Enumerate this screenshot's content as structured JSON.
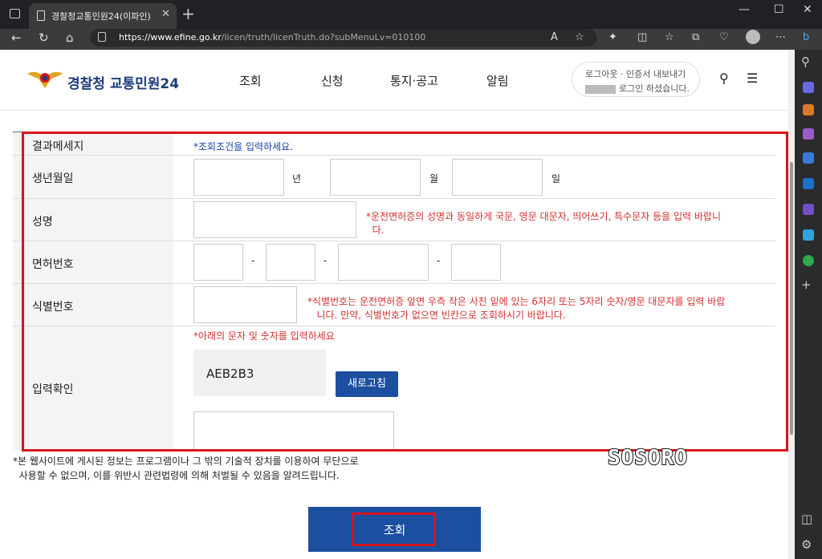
{
  "browser": {
    "tab_title": "경찰청교통민원24(이파인)",
    "url_host": "https://www.efine.go.kr",
    "url_path": "/licen/truth/licenTruth.do?subMenuLv=010100",
    "icons": [
      "back-icon",
      "refresh-icon",
      "home-icon",
      "lock-icon",
      "read-aloud-icon",
      "favorite-icon",
      "extensions-icon",
      "split-screen-icon",
      "favorites-icon",
      "collections-icon",
      "performance-icon",
      "profile-icon",
      "more-icon",
      "bing-icon"
    ]
  },
  "header": {
    "logo_text": "경찰청",
    "logo_sub": "교통민원24",
    "menu": [
      "조회",
      "신청",
      "통지·공고",
      "알림"
    ],
    "login_line1": "로그아웃 · 인증서 내보내기",
    "login_line2": "로그인 하셨습니다."
  },
  "form": {
    "result_label": "결과메세지",
    "result_message": "*조회조건을 입력하세요.",
    "birth_label": "생년월일",
    "year_unit": "년",
    "month_unit": "월",
    "day_unit": "일",
    "name_label": "성명",
    "name_note_1": "*운전면허증의 성명과 동일하게 국문, 영문 대문자, 띄어쓰기, 특수문자 등을 입력 바랍니",
    "name_note_2": "다.",
    "license_label": "면허번호",
    "dash": "-",
    "id_label": "식별번호",
    "id_note_1": "*식별번호는 운전면허증 앞면 우측 작은 사진 밑에 있는 6자리 또는 5자리 숫자/영문 대문자를 입력 바랍",
    "id_note_2": "니다. 만약, 식별번호가 없으면 빈칸으로 조회하시기 바랍니다.",
    "captcha_label": "입력확인",
    "captcha_note": "*아래의 문자 및 숫자를 입력하세요",
    "captcha_code": "AEB2B3",
    "refresh_label": "새로고침"
  },
  "notice_1": "*본 웹사이트에 게시된 정보는 프로그램이나 그 밖의 기술적 장치를 이용하여 무단으로",
  "notice_2": "사용할 수 없으며, 이를 위반시 관련법령에 의해 처벌될 수 있음을 알려드립니다.",
  "watermark": "SOSORO",
  "search_button": "조회",
  "colors": {
    "brand_blue": "#1c4fa0",
    "highlight_red": "#d7141e",
    "note_red": "#d32f2f"
  }
}
